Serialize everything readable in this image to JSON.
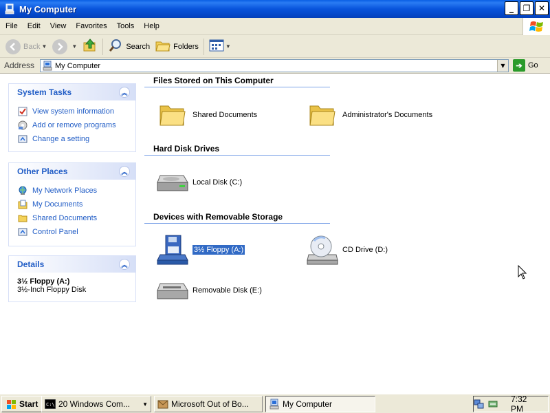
{
  "window": {
    "title": "My Computer",
    "buttons": {
      "minimize": "_",
      "restore": "❐",
      "close": "✕"
    }
  },
  "menu": [
    "File",
    "Edit",
    "View",
    "Favorites",
    "Tools",
    "Help"
  ],
  "toolbar": {
    "back": "Back",
    "search": "Search",
    "folders": "Folders"
  },
  "address": {
    "label": "Address",
    "value": "My Computer",
    "go": "Go"
  },
  "sidebar": {
    "system_tasks": {
      "title": "System Tasks",
      "items": [
        "View system information",
        "Add or remove programs",
        "Change a setting"
      ]
    },
    "other_places": {
      "title": "Other Places",
      "items": [
        "My Network Places",
        "My Documents",
        "Shared Documents",
        "Control Panel"
      ]
    },
    "details": {
      "title": "Details",
      "name": "3½ Floppy (A:)",
      "description": "3½-Inch Floppy Disk"
    }
  },
  "sections": {
    "files": {
      "title": "Files Stored on This Computer",
      "items": [
        "Shared Documents",
        "Administrator's Documents"
      ]
    },
    "hdd": {
      "title": "Hard Disk Drives",
      "items": [
        "Local Disk (C:)"
      ]
    },
    "removable": {
      "title": "Devices with Removable Storage",
      "items": [
        "3½ Floppy (A:)",
        "CD Drive (D:)",
        "Removable Disk (E:)"
      ],
      "selected": "3½ Floppy (A:)"
    }
  },
  "taskbar": {
    "start": "Start",
    "tasks": [
      "20 Windows Com...",
      "Microsoft Out of Bo...",
      "My Computer"
    ],
    "active_task": "My Computer",
    "clock": "7:32 PM"
  },
  "colors": {
    "title_bar": "#0854dc",
    "panel_link": "#215dc6",
    "selection": "#316ac5"
  }
}
